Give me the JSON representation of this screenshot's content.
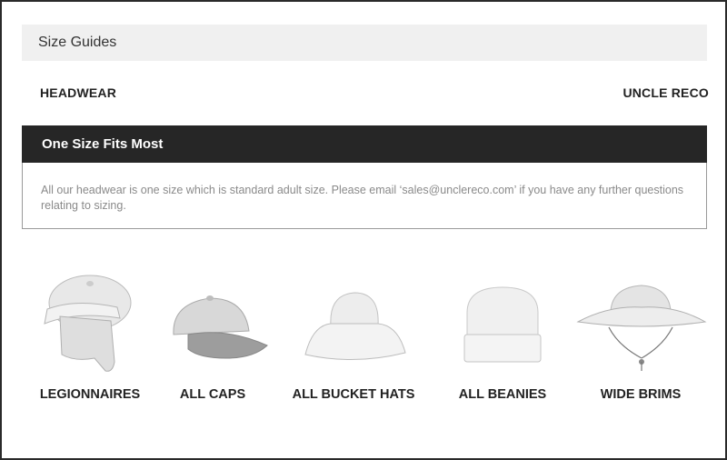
{
  "header": {
    "title": "Size Guides"
  },
  "labels": {
    "left": "HEADWEAR",
    "right": "UNCLE RECO"
  },
  "panel": {
    "title": "One Size Fits Most",
    "body": "All our headwear is one size which is standard adult size. Please email ‘sales@unclereco.com’ if you have any further questions relating to sizing."
  },
  "products": [
    {
      "label": "LEGIONNAIRES",
      "icon": "legionnaire-hat-icon"
    },
    {
      "label": "ALL CAPS",
      "icon": "cap-icon"
    },
    {
      "label": "ALL BUCKET HATS",
      "icon": "bucket-hat-icon"
    },
    {
      "label": "ALL BEANIES",
      "icon": "beanie-icon"
    },
    {
      "label": "WIDE BRIMS",
      "icon": "wide-brim-hat-icon"
    }
  ]
}
